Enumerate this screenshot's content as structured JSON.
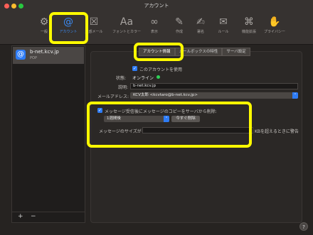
{
  "window": {
    "title": "アカウント"
  },
  "toolbar": {
    "items": [
      {
        "label": "一般",
        "icon": "gear-icon"
      },
      {
        "label": "アカウント",
        "icon": "at-icon",
        "active": true
      },
      {
        "label": "迷惑メール",
        "icon": "junk-mail-icon"
      },
      {
        "label": "フォントとカラー",
        "icon": "font-icon"
      },
      {
        "label": "表示",
        "icon": "glasses-icon"
      },
      {
        "label": "作成",
        "icon": "compose-icon"
      },
      {
        "label": "署名",
        "icon": "signature-icon"
      },
      {
        "label": "ルール",
        "icon": "rules-icon"
      },
      {
        "label": "機能拡張",
        "icon": "puzzle-icon"
      },
      {
        "label": "プライバシー",
        "icon": "hand-icon"
      }
    ]
  },
  "sidebar": {
    "account": {
      "name": "b-net.kcv.jp",
      "type": "POP"
    },
    "add_label": "+",
    "remove_label": "−"
  },
  "tabs": [
    {
      "label": "アカウント情報",
      "active": true
    },
    {
      "label": "メールボックスの特性"
    },
    {
      "label": "サーバ設定"
    }
  ],
  "form": {
    "enable_label": "このアカウントを使用",
    "status_label": "状態:",
    "status_value": "オンライン",
    "desc_label": "説明:",
    "desc_value": "b-net.kcv.jp",
    "email_label": "メールアドレス:",
    "email_value": "KCV太郎 <kcvtaro@b-net.kcv.jp>",
    "remove_copy_label": "メッセージ受信後にメッセージのコピーをサーバから削除:",
    "period_value": "1週間後",
    "remove_now_label": "今すぐ削除",
    "size_label": "メッセージのサイズが",
    "size_suffix": "KBを超えるときに警告"
  },
  "help_label": "?",
  "colors": {
    "accent": "#2e7cf6",
    "highlight": "#fffb00",
    "online": "#2fd158"
  }
}
